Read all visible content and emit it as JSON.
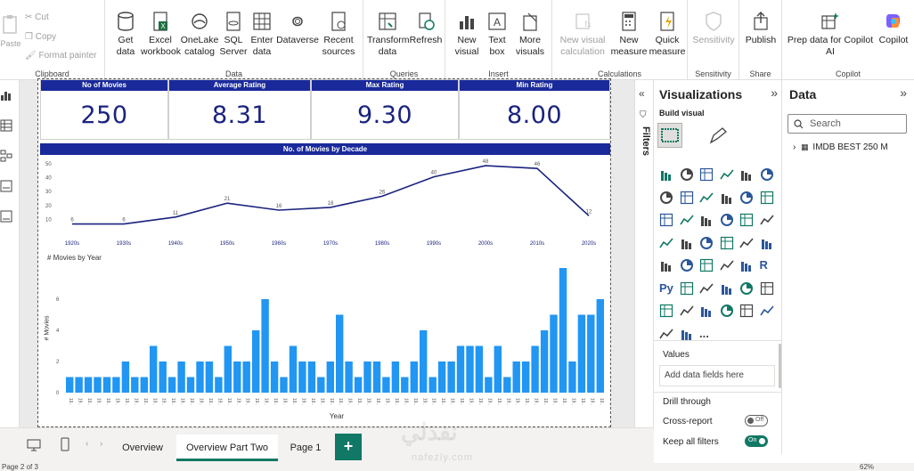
{
  "ribbon": {
    "clipboard": {
      "label": "Clipboard",
      "paste": "Paste",
      "cut": "Cut",
      "copy": "Copy",
      "format_painter": "Format painter"
    },
    "data": {
      "label": "Data",
      "get_data": "Get data",
      "excel": "Excel workbook",
      "onelake": "OneLake catalog",
      "sql": "SQL Server",
      "enter": "Enter data",
      "dataverse": "Dataverse",
      "recent": "Recent sources"
    },
    "queries": {
      "label": "Queries",
      "transform": "Transform data",
      "refresh": "Refresh"
    },
    "insert": {
      "label": "Insert",
      "new_visual": "New visual",
      "text_box": "Text box",
      "more_visuals": "More visuals"
    },
    "calculations": {
      "label": "Calculations",
      "new_visual_calc": "New visual calculation",
      "new_measure": "New measure",
      "quick_measure": "Quick measure"
    },
    "sensitivity": {
      "label": "Sensitivity",
      "btn": "Sensitivity"
    },
    "share": {
      "label": "Share",
      "publish": "Publish"
    },
    "copilot": {
      "label": "Copilot",
      "prep": "Prep data for Copilot AI",
      "copilot": "Copilot"
    }
  },
  "report": {
    "kpis": [
      {
        "title": "No of Movies",
        "value": "250"
      },
      {
        "title": "Average Rating",
        "value": "8.31"
      },
      {
        "title": "Max Rating",
        "value": "9.30"
      },
      {
        "title": "Min Rating",
        "value": "8.00"
      }
    ],
    "line_title": "No. of Movies by Decade",
    "bar_title": "# Movies by Year",
    "bar_ylabel": "# Movies",
    "bar_xlabel": "Year"
  },
  "chart_data": [
    {
      "type": "line",
      "title": "No. of Movies by Decade",
      "categories": [
        "1920s",
        "1930s",
        "1940s",
        "1950s",
        "1960s",
        "1970s",
        "1980s",
        "1990s",
        "2000s",
        "2010s",
        "2020s"
      ],
      "values": [
        6,
        6,
        11,
        21,
        16,
        18,
        26,
        40,
        48,
        46,
        12
      ],
      "yticks": [
        10,
        20,
        30,
        40,
        50
      ],
      "ylim": [
        0,
        50
      ],
      "color": "#1a237e"
    },
    {
      "type": "bar",
      "title": "# Movies by Year",
      "ylabel": "# Movies",
      "xlabel": "Year",
      "yticks": [
        0,
        2,
        4,
        6
      ],
      "ylim": [
        0,
        8
      ],
      "tick_label": "19..",
      "values": [
        1,
        1,
        1,
        1,
        1,
        1,
        2,
        1,
        1,
        3,
        2,
        1,
        2,
        1,
        2,
        2,
        1,
        3,
        2,
        2,
        4,
        6,
        2,
        1,
        3,
        2,
        2,
        1,
        2,
        5,
        2,
        1,
        2,
        2,
        1,
        2,
        1,
        2,
        4,
        1,
        2,
        2,
        3,
        3,
        3,
        1,
        3,
        1,
        2,
        2,
        3,
        4,
        5,
        8,
        2,
        5,
        5,
        6
      ],
      "color": "#2196f3"
    }
  ],
  "filters": {
    "label": "Filters"
  },
  "viz_pane": {
    "title": "Visualizations",
    "build": "Build visual",
    "values_label": "Values",
    "values_placeholder": "Add data fields here",
    "drill": "Drill through",
    "cross_report": "Cross-report",
    "cross_state": "Off",
    "keep_filters": "Keep all filters",
    "keep_state": "On",
    "more": "...",
    "r_label": "R",
    "py_label": "Py"
  },
  "data_pane": {
    "title": "Data",
    "search_placeholder": "Search",
    "table": "IMDB BEST 250 M"
  },
  "pages": [
    "Overview",
    "Overview Part Two",
    "Page 1"
  ],
  "add_page": "+",
  "status": {
    "page": "Page 2 of 3",
    "zoom": "62%"
  },
  "watermark": {
    "ar": "نفذلي",
    "en": "nafezly.com"
  }
}
